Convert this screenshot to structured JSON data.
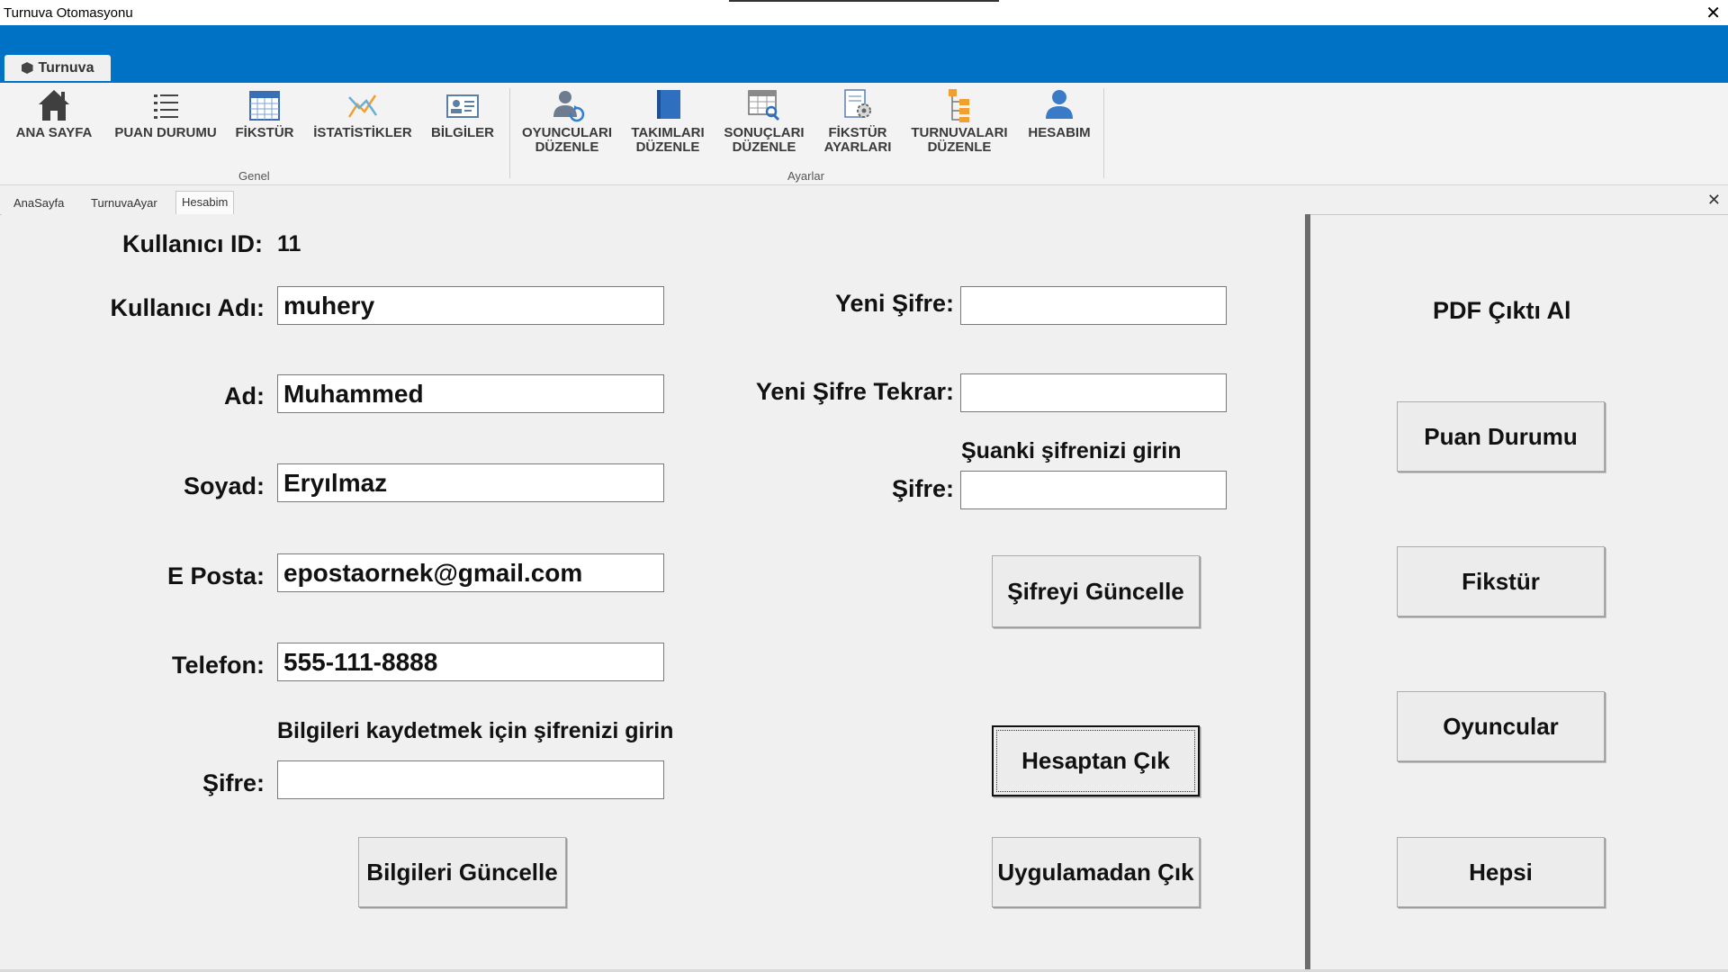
{
  "window": {
    "title": "Turnuva Otomasyonu",
    "close_glyph": "✕"
  },
  "ribbon": {
    "tab_label": "Turnuva",
    "groups": {
      "general": "Genel",
      "settings": "Ayarlar"
    },
    "buttons": {
      "home": [
        "ANA SAYFA"
      ],
      "standings": [
        "PUAN DURUMU"
      ],
      "fixture": [
        "FİKSTÜR"
      ],
      "stats": [
        "İSTATİSTİKLER"
      ],
      "info": [
        "BİLGİLER"
      ],
      "edit_players": [
        "OYUNCULARI",
        "DÜZENLE"
      ],
      "edit_teams": [
        "TAKIMLARI",
        "DÜZENLE"
      ],
      "edit_results": [
        "SONUÇLARI",
        "DÜZENLE"
      ],
      "fixture_settings": [
        "FİKSTÜR",
        "AYARLARI"
      ],
      "edit_tournaments": [
        "TURNUVALARI",
        "DÜZENLE"
      ],
      "account": [
        "HESABIM"
      ]
    }
  },
  "doc_tabs": [
    "AnaSayfa",
    "TurnuvaAyar",
    "Hesabim"
  ],
  "account_form": {
    "user_id_label": "Kullanıcı ID:",
    "user_id_value": "11",
    "username_label": "Kullanıcı Adı:",
    "username_value": "muhery",
    "name_label": "Ad:",
    "name_value": "Muhammed",
    "surname_label": "Soyad:",
    "surname_value": "Eryılmaz",
    "email_label": "E Posta:",
    "email_value": "epostaornek@gmail.com",
    "phone_label": "Telefon:",
    "phone_value": "555-111-8888",
    "save_hint": "Bilgileri kaydetmek için şifrenizi girin",
    "password_label": "Şifre:",
    "password_value": "",
    "update_info_button": "Bilgileri Güncelle"
  },
  "password_form": {
    "new_password_label": "Yeni Şifre:",
    "new_password_value": "",
    "repeat_label": "Yeni Şifre Tekrar:",
    "repeat_value": "",
    "current_hint": "Şuanki şifrenizi girin",
    "current_label": "Şifre:",
    "current_value": "",
    "update_password_button": "Şifreyi Güncelle",
    "logout_button": "Hesaptan Çık",
    "exit_button": "Uygulamadan Çık"
  },
  "pdf_panel": {
    "heading": "PDF Çıktı Al",
    "buttons": [
      "Puan Durumu",
      "Fikstür",
      "Oyuncular",
      "Hepsi"
    ]
  },
  "colors": {
    "ribbon_blue": "#0072c6",
    "panel_bg": "#f0f0f0"
  }
}
